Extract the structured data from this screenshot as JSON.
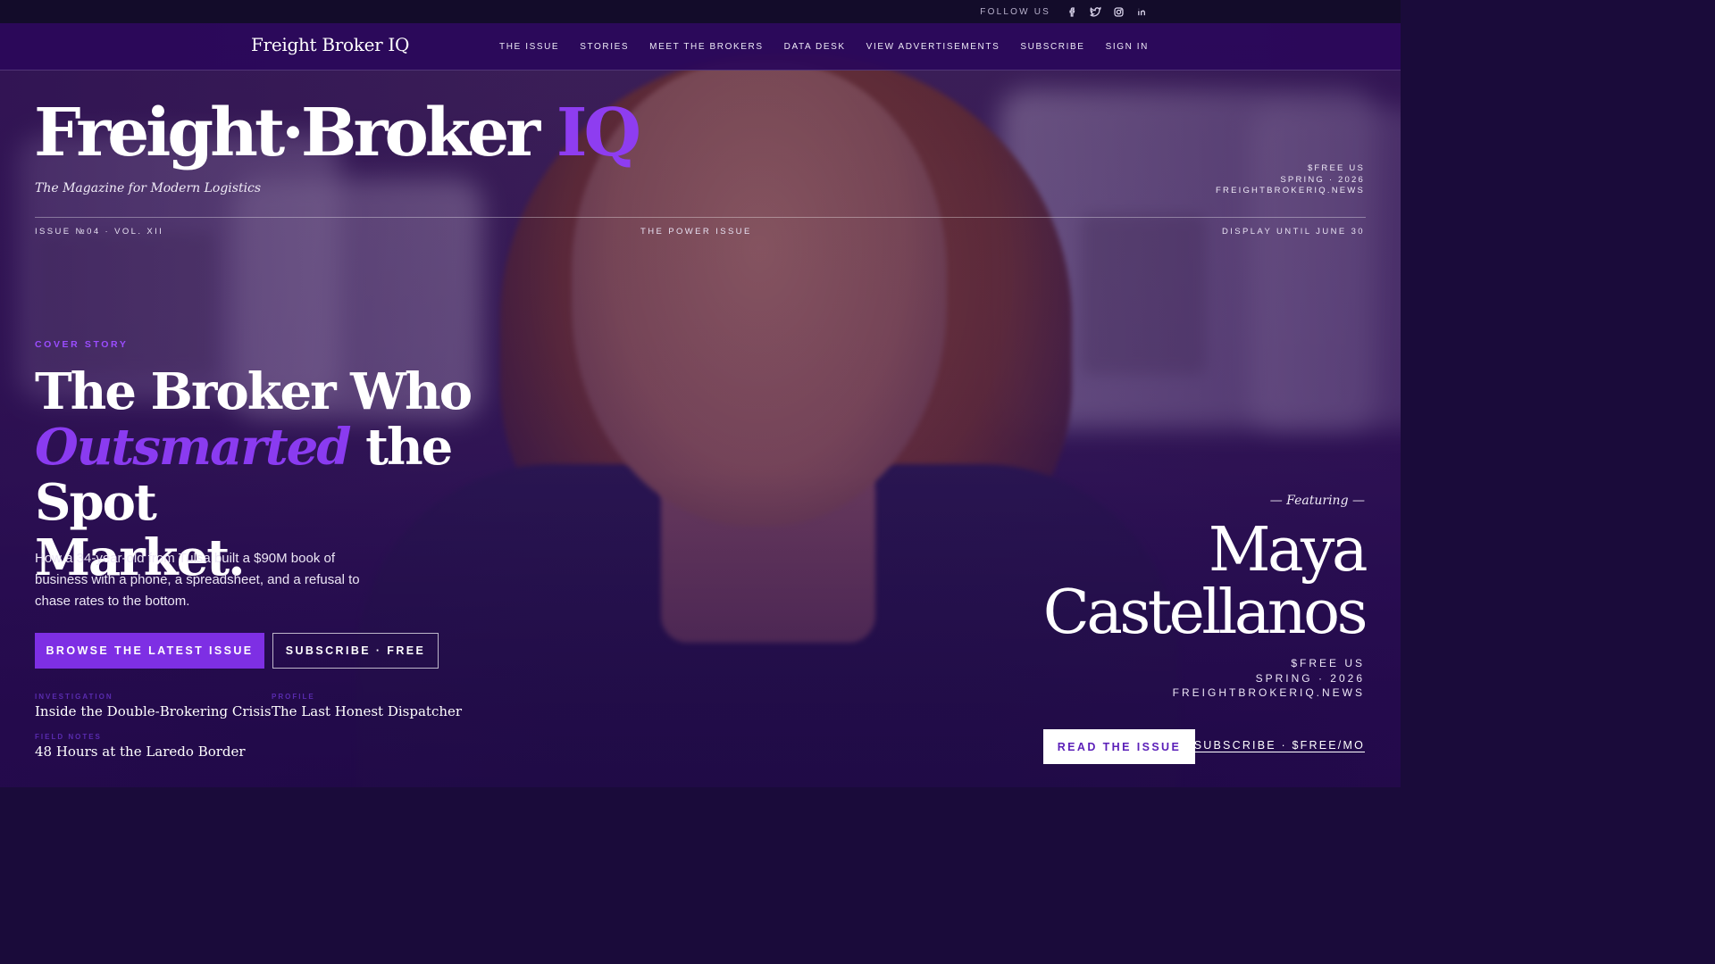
{
  "topbar": {
    "follow_label": "FOLLOW US",
    "social_icons": [
      "facebook-icon",
      "twitter-icon",
      "instagram-icon",
      "linkedin-icon"
    ]
  },
  "nav": {
    "brand": "Freight Broker IQ",
    "links": [
      "THE ISSUE",
      "STORIES",
      "MEET THE BROKERS",
      "DATA DESK",
      "VIEW ADVERTISEMENTS",
      "SUBSCRIBE",
      "SIGN IN"
    ]
  },
  "masthead": {
    "title_main": "Freight·Broker",
    "title_accent": "IQ",
    "tagline": "The Magazine for Modern Logistics",
    "meta": [
      "$FREE US",
      "SPRING · 2026",
      "FREIGHTBROKERIQ.NEWS"
    ],
    "issue_left": "ISSUE №04 · VOL. XII",
    "issue_center": "THE POWER ISSUE",
    "issue_right": "DISPLAY UNTIL JUNE 30"
  },
  "cover_story": {
    "eyebrow": "COVER STORY",
    "headline_line1": "The Broker Who",
    "headline_em": "Outsmarted",
    "headline_rest": "the Spot",
    "headline_line3": "Market.",
    "dek": "How a 34-year-old from Tulsa built a $90M book of business with a phone, a spreadsheet, and a refusal to chase rates to the bottom.",
    "primary_cta": "BROWSE THE LATEST ISSUE",
    "secondary_cta": "SUBSCRIBE · FREE"
  },
  "stories": [
    {
      "kicker": "INVESTIGATION",
      "title": "Inside the Double-Brokering Crisis"
    },
    {
      "kicker": "PROFILE",
      "title": "The Last Honest Dispatcher"
    },
    {
      "kicker": "FIELD NOTES",
      "title": "48 Hours at the Laredo Border"
    }
  ],
  "featuring": {
    "label": "— Featuring —",
    "name_line1": "Maya",
    "name_line2": "Castellanos",
    "meta": [
      "$FREE US",
      "SPRING · 2026",
      "FREIGHTBROKERIQ.NEWS"
    ],
    "read_cta": "READ THE ISSUE",
    "subscribe_link": "SUBSCRIBE · $FREE/MO"
  },
  "colors": {
    "accent": "#7e2fe4",
    "nav_bg": "#2a085a",
    "top_strip": "#130c2a"
  }
}
